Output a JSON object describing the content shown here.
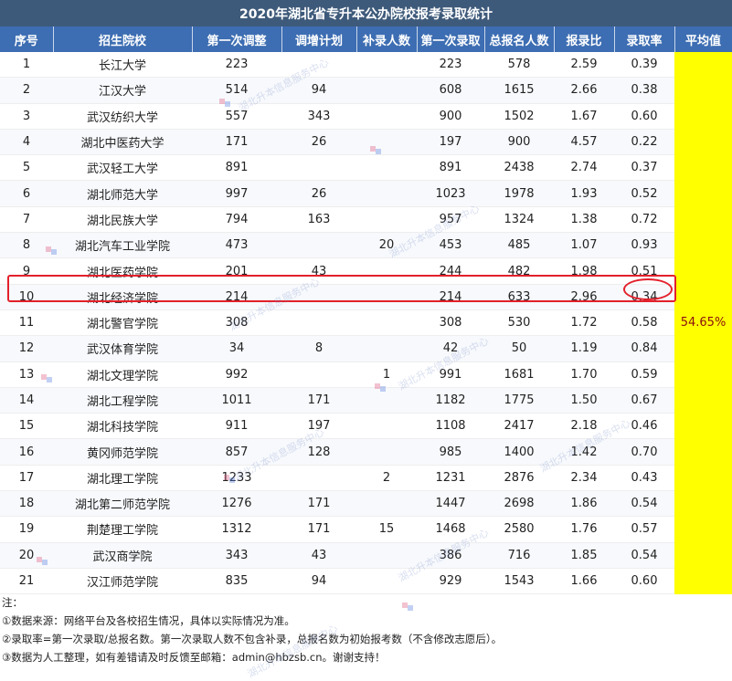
{
  "title": "2020年湖北省专升本公办院校报考录取统计",
  "headers": [
    "序号",
    "招生院校",
    "第一次调整",
    "调增计划",
    "补录人数",
    "第一次录取",
    "总报名人数",
    "报录比",
    "录取率",
    "平均值"
  ],
  "rows": [
    [
      "1",
      "长江大学",
      "223",
      "",
      "",
      "223",
      "578",
      "2.59",
      "0.39"
    ],
    [
      "2",
      "江汉大学",
      "514",
      "94",
      "",
      "608",
      "1615",
      "2.66",
      "0.38"
    ],
    [
      "3",
      "武汉纺织大学",
      "557",
      "343",
      "",
      "900",
      "1502",
      "1.67",
      "0.60"
    ],
    [
      "4",
      "湖北中医药大学",
      "171",
      "26",
      "",
      "197",
      "900",
      "4.57",
      "0.22"
    ],
    [
      "5",
      "武汉轻工大学",
      "891",
      "",
      "",
      "891",
      "2438",
      "2.74",
      "0.37"
    ],
    [
      "6",
      "湖北师范大学",
      "997",
      "26",
      "",
      "1023",
      "1978",
      "1.93",
      "0.52"
    ],
    [
      "7",
      "湖北民族大学",
      "794",
      "163",
      "",
      "957",
      "1324",
      "1.38",
      "0.72"
    ],
    [
      "8",
      "湖北汽车工业学院",
      "473",
      "",
      "20",
      "453",
      "485",
      "1.07",
      "0.93"
    ],
    [
      "9",
      "湖北医药学院",
      "201",
      "43",
      "",
      "244",
      "482",
      "1.98",
      "0.51"
    ],
    [
      "10",
      "湖北经济学院",
      "214",
      "",
      "",
      "214",
      "633",
      "2.96",
      "0.34"
    ],
    [
      "11",
      "湖北警官学院",
      "308",
      "",
      "",
      "308",
      "530",
      "1.72",
      "0.58"
    ],
    [
      "12",
      "武汉体育学院",
      "34",
      "8",
      "",
      "42",
      "50",
      "1.19",
      "0.84"
    ],
    [
      "13",
      "湖北文理学院",
      "992",
      "",
      "1",
      "991",
      "1681",
      "1.70",
      "0.59"
    ],
    [
      "14",
      "湖北工程学院",
      "1011",
      "171",
      "",
      "1182",
      "1775",
      "1.50",
      "0.67"
    ],
    [
      "15",
      "湖北科技学院",
      "911",
      "197",
      "",
      "1108",
      "2417",
      "2.18",
      "0.46"
    ],
    [
      "16",
      "黄冈师范学院",
      "857",
      "128",
      "",
      "985",
      "1400",
      "1.42",
      "0.70"
    ],
    [
      "17",
      "湖北理工学院",
      "1233",
      "",
      "2",
      "1231",
      "2876",
      "2.34",
      "0.43"
    ],
    [
      "18",
      "湖北第二师范学院",
      "1276",
      "171",
      "",
      "1447",
      "2698",
      "1.86",
      "0.54"
    ],
    [
      "19",
      "荆楚理工学院",
      "1312",
      "171",
      "15",
      "1468",
      "2580",
      "1.76",
      "0.57"
    ],
    [
      "20",
      "武汉商学院",
      "343",
      "43",
      "",
      "386",
      "716",
      "1.85",
      "0.54"
    ],
    [
      "21",
      "汉江师范学院",
      "835",
      "94",
      "",
      "929",
      "1543",
      "1.66",
      "0.60"
    ]
  ],
  "average": "54.65%",
  "highlighted_row": "10",
  "notes_label": "注：",
  "notes": [
    "①数据来源：网络平台及各校招生情况，具体以实际情况为准。",
    "②录取率=第一次录取/总报名数。第一次录取人数不包含补录，总报名数为初始报考数（不含修改志愿后）。",
    "③数据为人工整理，如有差错请及时反馈至邮箱：admin@hbzsb.cn。谢谢支持！"
  ],
  "watermark": "湖北升本信息服务中心",
  "colors": {
    "title_bg": "#3e5a7a",
    "header_bg": "#3d6db2",
    "average_bg": "#ffff00",
    "highlight": "#e3202b"
  }
}
